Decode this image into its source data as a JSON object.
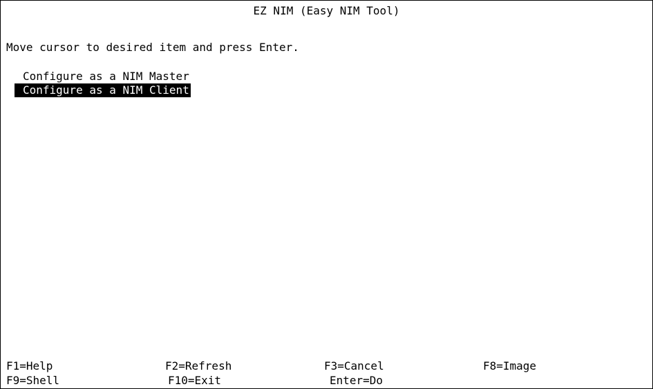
{
  "title": "EZ NIM (Easy NIM Tool)",
  "instructions": "Move cursor to desired item and press Enter.",
  "menu": {
    "items": [
      {
        "label": "Configure as a NIM Master",
        "selected": false
      },
      {
        "label": "Configure as a NIM Client",
        "selected": true
      }
    ]
  },
  "function_keys": {
    "row1": [
      "F1=Help",
      "F2=Refresh",
      "F3=Cancel",
      "F8=Image"
    ],
    "row2": [
      "F9=Shell",
      "F10=Exit",
      "Enter=Do"
    ]
  },
  "colors": {
    "background": "#ffffff",
    "text": "#000000",
    "selection_background": "#000000",
    "selection_text": "#ffffff"
  }
}
